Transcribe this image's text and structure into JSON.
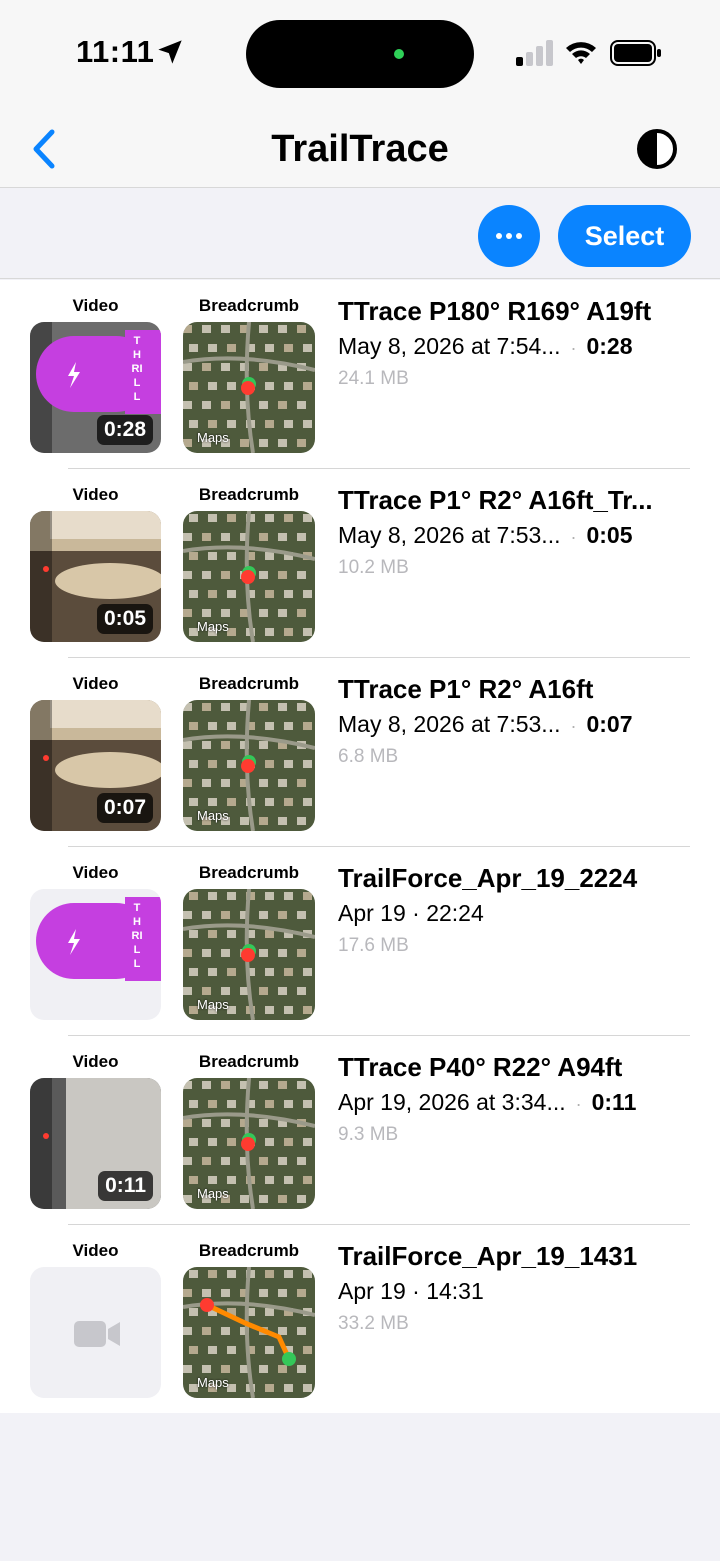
{
  "status_bar": {
    "time": "11:11"
  },
  "nav": {
    "title": "TrailTrace"
  },
  "toolbar": {
    "more_label": "•••",
    "select_label": "Select"
  },
  "columns": {
    "video": "Video",
    "breadcrumb": "Breadcrumb"
  },
  "map_attribution": "Maps",
  "thrill_letters": [
    "T",
    "H",
    "RI",
    "L",
    "L"
  ],
  "colors": {
    "accent": "#0a84ff",
    "thrill": "#c53fe0",
    "route": "#ff8a00",
    "start_marker": "#ff3b30",
    "end_marker": "#34c759"
  },
  "rows": [
    {
      "title": "TTrace P180° R169° A19ft",
      "date": "May 8, 2026 at 7:54...",
      "duration": "0:28",
      "size": "24.1 MB",
      "video_type": "thrill-overlay",
      "badge": "0:28"
    },
    {
      "title": "TTrace P1° R2° A16ft_Tr...",
      "date": "May 8, 2026 at 7:53...",
      "duration": "0:05",
      "size": "10.2 MB",
      "video_type": "floor",
      "badge": "0:05"
    },
    {
      "title": "TTrace P1° R2° A16ft",
      "date": "May 8, 2026 at 7:53...",
      "duration": "0:07",
      "size": "6.8 MB",
      "video_type": "floor",
      "badge": "0:07"
    },
    {
      "title": "TrailForce_Apr_19_2224",
      "date": "Apr 19 · 22:24",
      "duration": "",
      "size": "17.6 MB",
      "video_type": "thrill-only",
      "badge": ""
    },
    {
      "title": "TTrace P40° R22° A94ft",
      "date": "Apr 19, 2026 at 3:34...",
      "duration": "0:11",
      "size": "9.3 MB",
      "video_type": "wall",
      "badge": "0:11"
    },
    {
      "title": "TrailForce_Apr_19_1431",
      "date": "Apr 19 · 14:31",
      "duration": "",
      "size": "33.2 MB",
      "video_type": "placeholder",
      "badge": ""
    }
  ]
}
